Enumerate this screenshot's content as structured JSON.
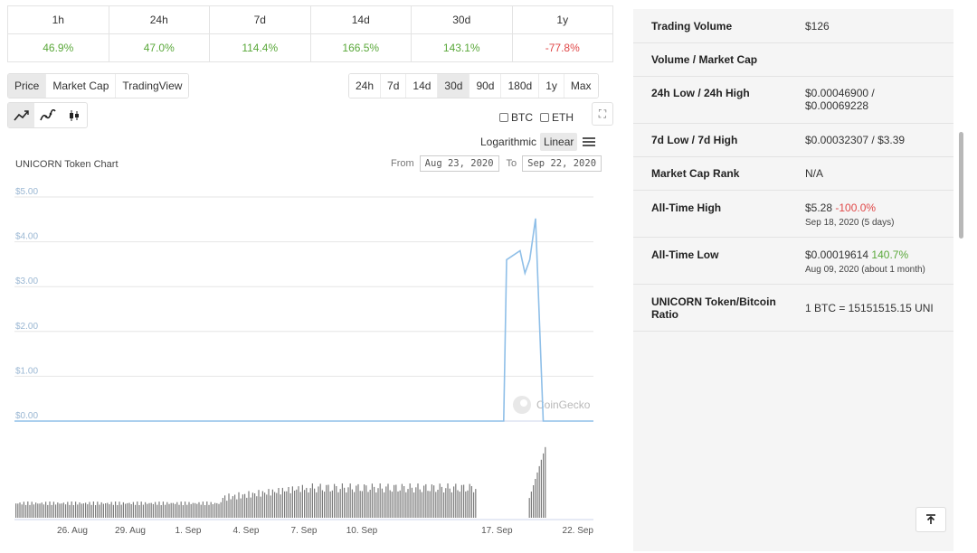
{
  "performance": {
    "periods": [
      "1h",
      "24h",
      "7d",
      "14d",
      "30d",
      "1y"
    ],
    "changes": [
      {
        "value": "46.9%",
        "trend": "pos"
      },
      {
        "value": "47.0%",
        "trend": "pos"
      },
      {
        "value": "114.4%",
        "trend": "pos"
      },
      {
        "value": "166.5%",
        "trend": "pos"
      },
      {
        "value": "143.1%",
        "trend": "pos"
      },
      {
        "value": "-77.8%",
        "trend": "neg"
      }
    ]
  },
  "chart_tabs": [
    "Price",
    "Market Cap",
    "TradingView"
  ],
  "range_tabs": [
    "24h",
    "7d",
    "14d",
    "30d",
    "90d",
    "180d",
    "1y",
    "Max"
  ],
  "active_range": "30d",
  "chart_icons": [
    "line-chart-icon",
    "smooth-line-chart-icon",
    "candlestick-icon"
  ],
  "compare": {
    "btc": "BTC",
    "eth": "ETH"
  },
  "scale": {
    "log": "Logarithmic",
    "linear": "Linear"
  },
  "chart_title": "UNICORN Token Chart",
  "date_range": {
    "from_label": "From",
    "from": "Aug 23, 2020",
    "to_label": "To",
    "to": "Sep 22, 2020"
  },
  "watermark": "CoinGecko",
  "chart_data": {
    "type": "line",
    "title": "",
    "y_ticks": [
      "$5.00",
      "$4.00",
      "$3.00",
      "$2.00",
      "$1.00",
      "$0.00"
    ],
    "ylim": [
      0,
      5
    ],
    "x_ticks": [
      "26. Aug",
      "29. Aug",
      "1. Sep",
      "4. Sep",
      "7. Sep",
      "10. Sep",
      "17. Sep",
      "22. Sep"
    ],
    "series": [
      {
        "values_note": "",
        "x": [
          "Aug 23",
          "Sep 17",
          "Sep 17",
          "Sep 18",
          "Sep 18",
          "Sep 18",
          "Sep 19",
          "Sep 19",
          "Sep 19"
        ],
        "y": [
          0.0003,
          0.0005,
          3.6,
          3.8,
          3.3,
          3.6,
          4.52,
          0.0005,
          0.0005
        ]
      }
    ],
    "volume_profile": "low-flat then rising from 1. Sep, gap 12-16 Sep, spike near 18 Sep"
  },
  "stats": [
    {
      "label": "Trading Volume",
      "value": "$126"
    },
    {
      "label": "Volume / Market Cap",
      "value": ""
    },
    {
      "label": "24h Low / 24h High",
      "value": "$0.00046900 /",
      "value2": "$0.00069228"
    },
    {
      "label": "7d Low / 7d High",
      "value": "$0.00032307 / $3.39"
    },
    {
      "label": "Market Cap Rank",
      "value": "N/A"
    },
    {
      "label": "All-Time High",
      "value": "$5.28",
      "change": "-100.0%",
      "change_trend": "neg",
      "sub": "Sep 18, 2020 (5 days)"
    },
    {
      "label": "All-Time Low",
      "value": "$0.00019614",
      "change": "140.7%",
      "change_trend": "pos",
      "sub": "Aug 09, 2020 (about 1 month)"
    },
    {
      "label": "UNICORN Token/Bitcoin",
      "label2": "Ratio",
      "value": "1 BTC = 15151515.15 UNI"
    }
  ],
  "colors": {
    "line": "#8fbfe8",
    "positive": "#5aa83a",
    "negative": "#e04848"
  }
}
